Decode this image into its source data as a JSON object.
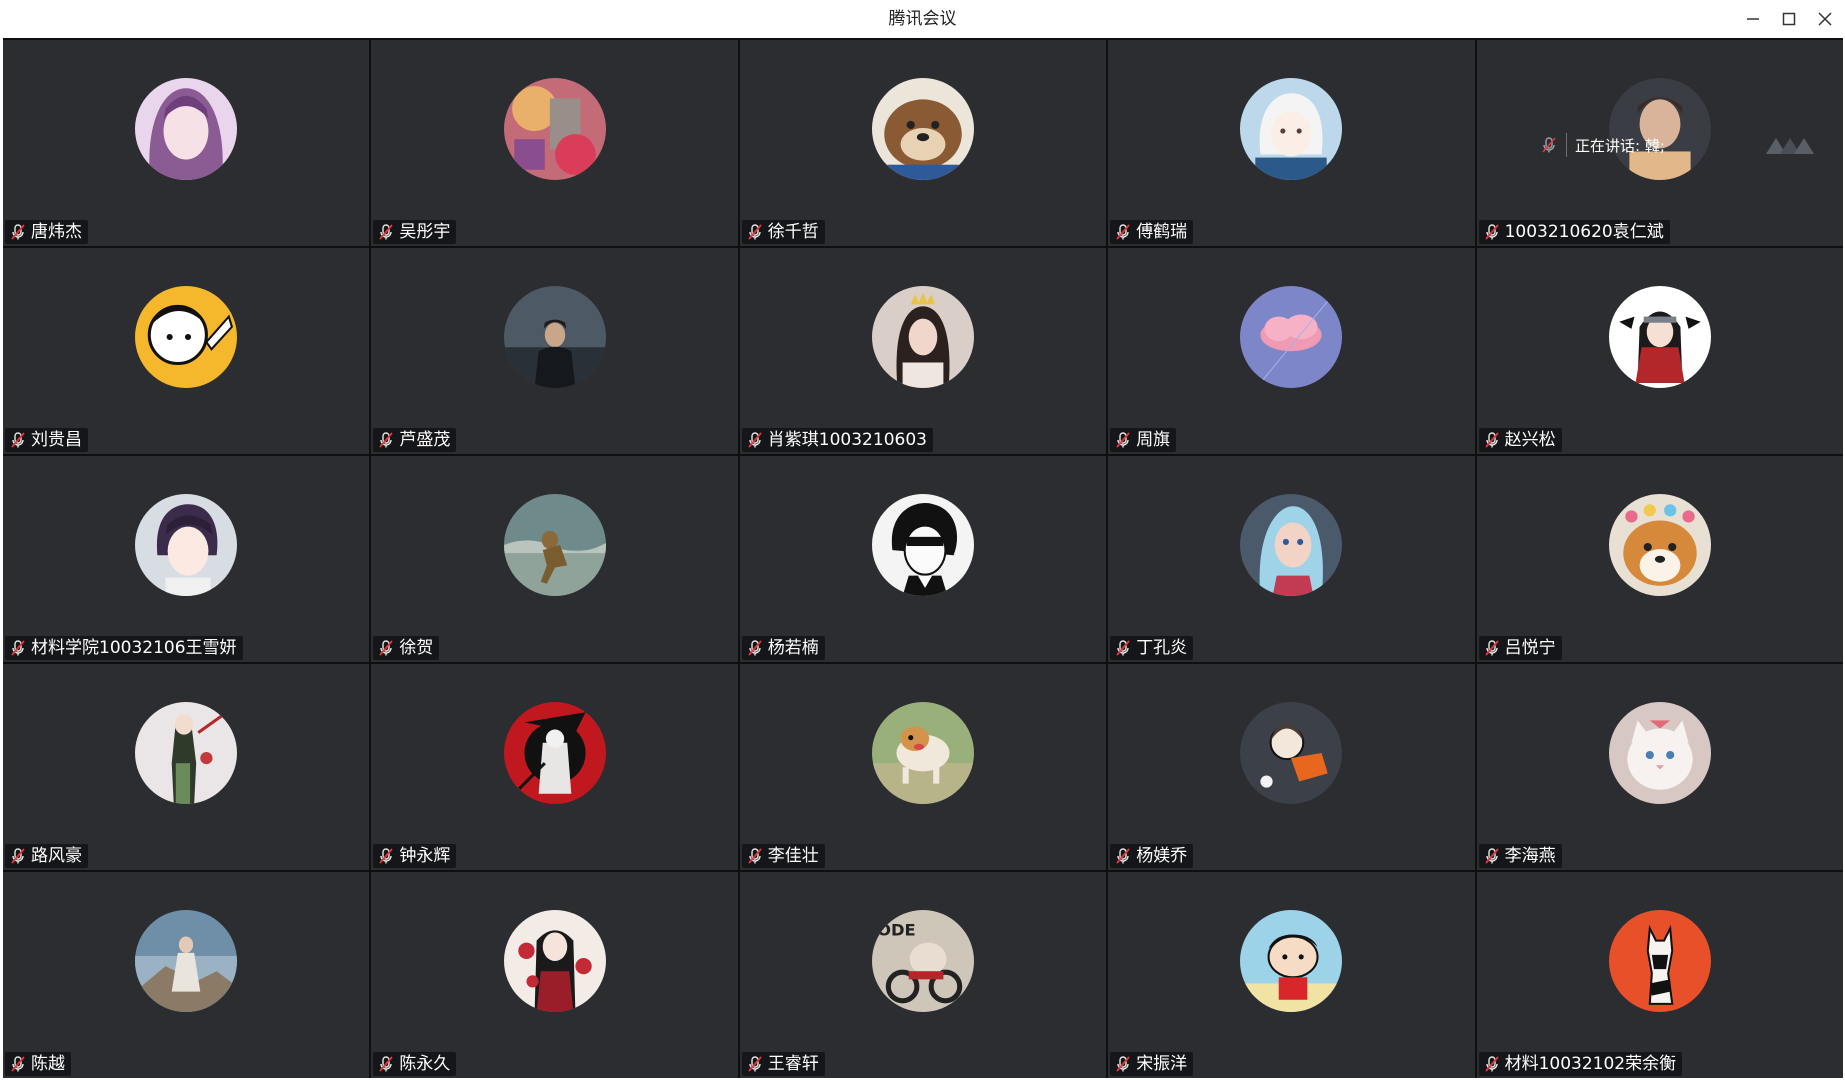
{
  "window": {
    "title": "腾讯会议",
    "controls": [
      "minimize-icon",
      "maximize-icon",
      "close-icon"
    ]
  },
  "speaking": {
    "label": "正在讲话: 韓;"
  },
  "colors": {
    "tile_bg": "#2b2d31",
    "grid_bg": "#0e0f11",
    "mic_muted": "#e03a3a",
    "name_text": "#ffffff"
  },
  "participants": [
    {
      "name": "唐炜杰",
      "avatar": "anime-girl-purple",
      "muted": true
    },
    {
      "name": "吴彤宇",
      "avatar": "colorful-collage",
      "muted": true
    },
    {
      "name": "徐千哲",
      "avatar": "cartoon-dog",
      "muted": true
    },
    {
      "name": "傅鹤瑞",
      "avatar": "anime-boy-white-hair",
      "muted": true
    },
    {
      "name": "1003210620袁仁斌",
      "avatar": "photo-man-portrait",
      "muted": true
    },
    {
      "name": "刘贵昌",
      "avatar": "cartoon-yellow-character",
      "muted": true
    },
    {
      "name": "芦盛茂",
      "avatar": "photo-man-dark-sky",
      "muted": true
    },
    {
      "name": "肖紫琪1003210603",
      "avatar": "photo-girl-birthday",
      "muted": true
    },
    {
      "name": "周旗",
      "avatar": "pink-cloud-blue-sky",
      "muted": true
    },
    {
      "name": "赵兴松",
      "avatar": "anime-ninja-red",
      "muted": true
    },
    {
      "name": "材料学院10032106王雪妍",
      "avatar": "anime-boy-dark-hair",
      "muted": true
    },
    {
      "name": "徐贺",
      "avatar": "photo-figure-beach",
      "muted": true
    },
    {
      "name": "杨若楠",
      "avatar": "manga-man-sunglasses",
      "muted": true
    },
    {
      "name": "丁孔炎",
      "avatar": "elsa-cartoon",
      "muted": true
    },
    {
      "name": "吕悦宁",
      "avatar": "shiba-dog-flowers",
      "muted": true
    },
    {
      "name": "路风豪",
      "avatar": "anime-figure-sword",
      "muted": true
    },
    {
      "name": "钟永辉",
      "avatar": "red-warrior-art",
      "muted": true
    },
    {
      "name": "李佳壮",
      "avatar": "photo-dog-running",
      "muted": true
    },
    {
      "name": "杨媄乔",
      "avatar": "cartoon-girl-orange",
      "muted": true
    },
    {
      "name": "李海燕",
      "avatar": "photo-white-cat",
      "muted": true
    },
    {
      "name": "陈越",
      "avatar": "photo-person-cliff",
      "muted": true
    },
    {
      "name": "陈永久",
      "avatar": "anime-man-red-flowers",
      "muted": true
    },
    {
      "name": "王睿轩",
      "avatar": "cartoon-bear-motorbike",
      "muted": true
    },
    {
      "name": "宋振洋",
      "avatar": "crayon-shinchan",
      "muted": true
    },
    {
      "name": "材料10032102荣余衡",
      "avatar": "cat-orange-background",
      "muted": true
    }
  ]
}
